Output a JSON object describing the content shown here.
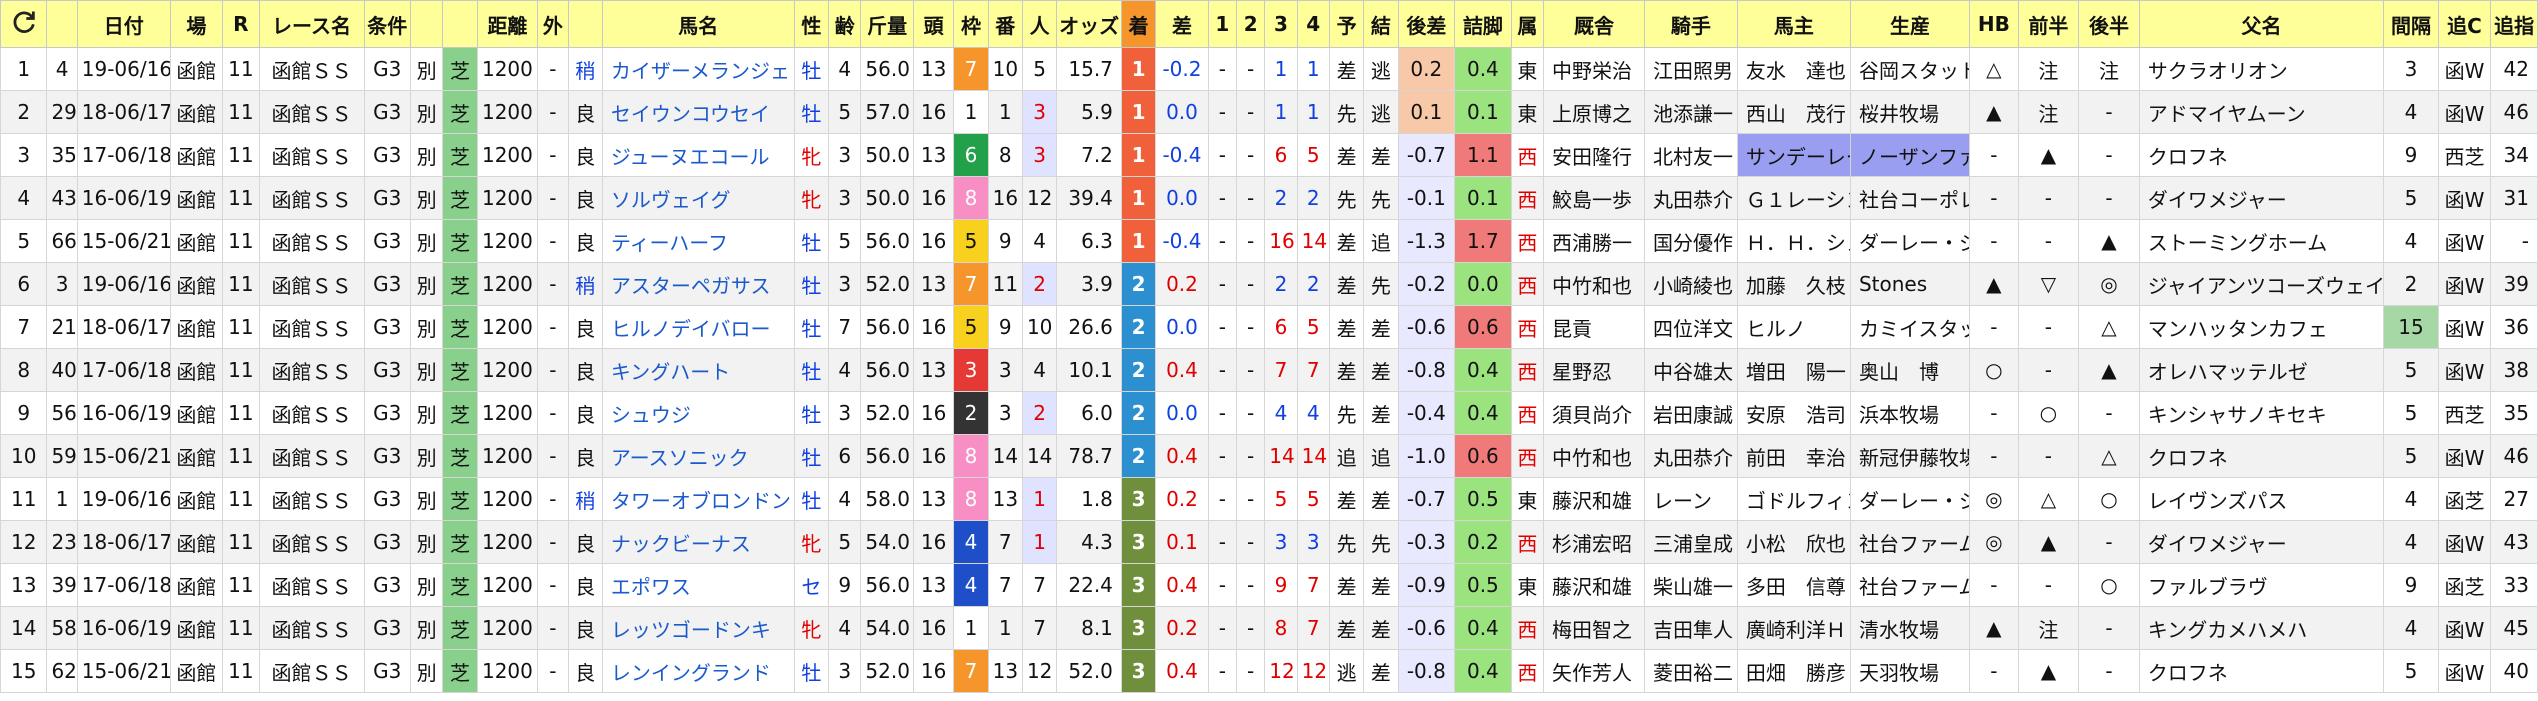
{
  "header": {
    "refresh_icon": "refresh-icon",
    "columns": [
      "日付",
      "場",
      "R",
      "レース名",
      "条件",
      "",
      "",
      "距離",
      "外",
      "",
      "馬名",
      "性",
      "齢",
      "斤量",
      "頭",
      "枠",
      "番",
      "人",
      "オッズ",
      "着",
      "差",
      "1",
      "2",
      "3",
      "4",
      "予",
      "結",
      "後差",
      "詰脚",
      "属",
      "厩舎",
      "騎手",
      "馬主",
      "生産",
      "HB",
      "前半",
      "後半",
      "父名",
      "間隔",
      "追C",
      "追指"
    ]
  },
  "rows": [
    {
      "no": "1",
      "idx": "4",
      "date": "19-06/16",
      "place": "函館",
      "r": "11",
      "race": "函館ＳＳ",
      "grade": "G3",
      "cond": "別",
      "surf": "芝",
      "dist": "1200",
      "out": "-",
      "weight_mark": "稍",
      "name": "カイザーメランジェ",
      "sex": "牡",
      "age": "4",
      "kin": "56.0",
      "heads": "13",
      "waku": "7",
      "ban": "10",
      "pop": "5",
      "odds": "15.7",
      "fin": "1",
      "diff": "-0.2",
      "c1": "-",
      "c2": "-",
      "c3": "1",
      "c4": "1",
      "yo": "差",
      "ketsu": "逃",
      "agari": "0.2",
      "tsume": "0.4",
      "zoku": "東",
      "stable": "中野栄治",
      "jockey": "江田照男",
      "owner": "友水　達也",
      "breeder": "谷岡スタット",
      "hb": "△",
      "zen": "注",
      "kou": "注",
      "sire": "サクラオリオン",
      "interval": "3",
      "oic": "函W",
      "oishi": "42"
    },
    {
      "no": "2",
      "idx": "29",
      "date": "18-06/17",
      "place": "函館",
      "r": "11",
      "race": "函館ＳＳ",
      "grade": "G3",
      "cond": "別",
      "surf": "芝",
      "dist": "1200",
      "out": "-",
      "weight_mark": "良",
      "name": "セイウンコウセイ",
      "sex": "牡",
      "age": "5",
      "kin": "57.0",
      "heads": "16",
      "waku": "1",
      "ban": "1",
      "pop": "3",
      "odds": "5.9",
      "fin": "1",
      "diff": "0.0",
      "c1": "-",
      "c2": "-",
      "c3": "1",
      "c4": "1",
      "yo": "先",
      "ketsu": "逃",
      "agari": "0.1",
      "tsume": "0.1",
      "zoku": "東",
      "stable": "上原博之",
      "jockey": "池添謙一",
      "owner": "西山　茂行",
      "breeder": "桜井牧場",
      "hb": "▲",
      "zen": "注",
      "kou": "-",
      "sire": "アドマイヤムーン",
      "interval": "4",
      "oic": "函W",
      "oishi": "46"
    },
    {
      "no": "3",
      "idx": "35",
      "date": "17-06/18",
      "place": "函館",
      "r": "11",
      "race": "函館ＳＳ",
      "grade": "G3",
      "cond": "別",
      "surf": "芝",
      "dist": "1200",
      "out": "-",
      "weight_mark": "良",
      "name": "ジューヌエコール",
      "sex": "牝",
      "age": "3",
      "kin": "50.0",
      "heads": "13",
      "waku": "6",
      "ban": "8",
      "pop": "3",
      "odds": "7.2",
      "fin": "1",
      "diff": "-0.4",
      "c1": "-",
      "c2": "-",
      "c3": "6",
      "c4": "5",
      "yo": "差",
      "ketsu": "差",
      "agari": "-0.7",
      "tsume": "1.1",
      "zoku": "西",
      "stable": "安田隆行",
      "jockey": "北村友一",
      "owner": "サンデーレー",
      "breeder": "ノーザンファ",
      "hb": "-",
      "zen": "▲",
      "kou": "-",
      "sire": "クロフネ",
      "interval": "9",
      "oic": "西芝",
      "oishi": "34"
    },
    {
      "no": "4",
      "idx": "43",
      "date": "16-06/19",
      "place": "函館",
      "r": "11",
      "race": "函館ＳＳ",
      "grade": "G3",
      "cond": "別",
      "surf": "芝",
      "dist": "1200",
      "out": "-",
      "weight_mark": "良",
      "name": "ソルヴェイグ",
      "sex": "牝",
      "age": "3",
      "kin": "50.0",
      "heads": "16",
      "waku": "8",
      "ban": "16",
      "pop": "12",
      "odds": "39.4",
      "fin": "1",
      "diff": "0.0",
      "c1": "-",
      "c2": "-",
      "c3": "2",
      "c4": "2",
      "yo": "先",
      "ketsu": "先",
      "agari": "-0.1",
      "tsume": "0.1",
      "zoku": "西",
      "stable": "鮫島一歩",
      "jockey": "丸田恭介",
      "owner": "Ｇ１レーシン",
      "breeder": "社台コーポレ",
      "hb": "-",
      "zen": "-",
      "kou": "-",
      "sire": "ダイワメジャー",
      "interval": "5",
      "oic": "函W",
      "oishi": "31"
    },
    {
      "no": "5",
      "idx": "66",
      "date": "15-06/21",
      "place": "函館",
      "r": "11",
      "race": "函館ＳＳ",
      "grade": "G3",
      "cond": "別",
      "surf": "芝",
      "dist": "1200",
      "out": "-",
      "weight_mark": "良",
      "name": "ティーハーフ",
      "sex": "牡",
      "age": "5",
      "kin": "56.0",
      "heads": "16",
      "waku": "5",
      "ban": "9",
      "pop": "4",
      "odds": "6.3",
      "fin": "1",
      "diff": "-0.4",
      "c1": "-",
      "c2": "-",
      "c3": "16",
      "c4": "14",
      "yo": "差",
      "ketsu": "追",
      "agari": "-1.3",
      "tsume": "1.7",
      "zoku": "西",
      "stable": "西浦勝一",
      "jockey": "国分優作",
      "owner": "Ｈ．Ｈ．シェ",
      "breeder": "ダーレー・ジ",
      "hb": "-",
      "zen": "-",
      "kou": "▲",
      "sire": "ストーミングホーム",
      "interval": "4",
      "oic": "函W",
      "oishi": "-"
    },
    {
      "no": "6",
      "idx": "3",
      "date": "19-06/16",
      "place": "函館",
      "r": "11",
      "race": "函館ＳＳ",
      "grade": "G3",
      "cond": "別",
      "surf": "芝",
      "dist": "1200",
      "out": "-",
      "weight_mark": "稍",
      "name": "アスターペガサス",
      "sex": "牡",
      "age": "3",
      "kin": "52.0",
      "heads": "13",
      "waku": "7",
      "ban": "11",
      "pop": "2",
      "odds": "3.9",
      "fin": "2",
      "diff": "0.2",
      "c1": "-",
      "c2": "-",
      "c3": "2",
      "c4": "2",
      "yo": "差",
      "ketsu": "先",
      "agari": "-0.2",
      "tsume": "0.0",
      "zoku": "西",
      "stable": "中竹和也",
      "jockey": "小崎綾也",
      "owner": "加藤　久枝",
      "breeder": "Stones",
      "hb": "▲",
      "zen": "▽",
      "kou": "◎",
      "sire": "ジャイアンツコーズウェイ",
      "interval": "2",
      "oic": "函W",
      "oishi": "39"
    },
    {
      "no": "7",
      "idx": "21",
      "date": "18-06/17",
      "place": "函館",
      "r": "11",
      "race": "函館ＳＳ",
      "grade": "G3",
      "cond": "別",
      "surf": "芝",
      "dist": "1200",
      "out": "-",
      "weight_mark": "良",
      "name": "ヒルノデイバロー",
      "sex": "牡",
      "age": "7",
      "kin": "56.0",
      "heads": "16",
      "waku": "5",
      "ban": "9",
      "pop": "10",
      "odds": "26.6",
      "fin": "2",
      "diff": "0.0",
      "c1": "-",
      "c2": "-",
      "c3": "6",
      "c4": "5",
      "yo": "差",
      "ketsu": "差",
      "agari": "-0.6",
      "tsume": "0.6",
      "zoku": "西",
      "stable": "昆貢",
      "jockey": "四位洋文",
      "owner": "ヒルノ",
      "breeder": "カミイスタッ",
      "hb": "-",
      "zen": "-",
      "kou": "△",
      "sire": "マンハッタンカフェ",
      "interval": "15",
      "oic": "函W",
      "oishi": "36"
    },
    {
      "no": "8",
      "idx": "40",
      "date": "17-06/18",
      "place": "函館",
      "r": "11",
      "race": "函館ＳＳ",
      "grade": "G3",
      "cond": "別",
      "surf": "芝",
      "dist": "1200",
      "out": "-",
      "weight_mark": "良",
      "name": "キングハート",
      "sex": "牡",
      "age": "4",
      "kin": "56.0",
      "heads": "13",
      "waku": "3",
      "ban": "3",
      "pop": "4",
      "odds": "10.1",
      "fin": "2",
      "diff": "0.4",
      "c1": "-",
      "c2": "-",
      "c3": "7",
      "c4": "7",
      "yo": "差",
      "ketsu": "差",
      "agari": "-0.8",
      "tsume": "0.4",
      "zoku": "西",
      "stable": "星野忍",
      "jockey": "中谷雄太",
      "owner": "増田　陽一",
      "breeder": "奥山　博",
      "hb": "○",
      "zen": "-",
      "kou": "▲",
      "sire": "オレハマッテルゼ",
      "interval": "5",
      "oic": "函W",
      "oishi": "38"
    },
    {
      "no": "9",
      "idx": "56",
      "date": "16-06/19",
      "place": "函館",
      "r": "11",
      "race": "函館ＳＳ",
      "grade": "G3",
      "cond": "別",
      "surf": "芝",
      "dist": "1200",
      "out": "-",
      "weight_mark": "良",
      "name": "シュウジ",
      "sex": "牡",
      "age": "3",
      "kin": "52.0",
      "heads": "16",
      "waku": "2",
      "ban": "3",
      "pop": "2",
      "odds": "6.0",
      "fin": "2",
      "diff": "0.0",
      "c1": "-",
      "c2": "-",
      "c3": "4",
      "c4": "4",
      "yo": "先",
      "ketsu": "差",
      "agari": "-0.4",
      "tsume": "0.4",
      "zoku": "西",
      "stable": "須貝尚介",
      "jockey": "岩田康誠",
      "owner": "安原　浩司",
      "breeder": "浜本牧場",
      "hb": "-",
      "zen": "○",
      "kou": "-",
      "sire": "キンシャサノキセキ",
      "interval": "5",
      "oic": "西芝",
      "oishi": "35"
    },
    {
      "no": "10",
      "idx": "59",
      "date": "15-06/21",
      "place": "函館",
      "r": "11",
      "race": "函館ＳＳ",
      "grade": "G3",
      "cond": "別",
      "surf": "芝",
      "dist": "1200",
      "out": "-",
      "weight_mark": "良",
      "name": "アースソニック",
      "sex": "牡",
      "age": "6",
      "kin": "56.0",
      "heads": "16",
      "waku": "8",
      "ban": "14",
      "pop": "14",
      "odds": "78.7",
      "fin": "2",
      "diff": "0.4",
      "c1": "-",
      "c2": "-",
      "c3": "14",
      "c4": "14",
      "yo": "追",
      "ketsu": "追",
      "agari": "-1.0",
      "tsume": "0.6",
      "zoku": "西",
      "stable": "中竹和也",
      "jockey": "丸田恭介",
      "owner": "前田　幸治",
      "breeder": "新冠伊藤牧場",
      "hb": "-",
      "zen": "-",
      "kou": "△",
      "sire": "クロフネ",
      "interval": "5",
      "oic": "函W",
      "oishi": "46"
    },
    {
      "no": "11",
      "idx": "1",
      "date": "19-06/16",
      "place": "函館",
      "r": "11",
      "race": "函館ＳＳ",
      "grade": "G3",
      "cond": "別",
      "surf": "芝",
      "dist": "1200",
      "out": "-",
      "weight_mark": "稍",
      "name": "タワーオブロンドン",
      "sex": "牡",
      "age": "4",
      "kin": "58.0",
      "heads": "13",
      "waku": "8",
      "ban": "13",
      "pop": "1",
      "odds": "1.8",
      "fin": "3",
      "diff": "0.2",
      "c1": "-",
      "c2": "-",
      "c3": "5",
      "c4": "5",
      "yo": "差",
      "ketsu": "差",
      "agari": "-0.7",
      "tsume": "0.5",
      "zoku": "東",
      "stable": "藤沢和雄",
      "jockey": "レーン",
      "owner": "ゴドルフィン",
      "breeder": "ダーレー・ジ",
      "hb": "◎",
      "zen": "△",
      "kou": "○",
      "sire": "レイヴンズパス",
      "interval": "4",
      "oic": "函芝",
      "oishi": "27"
    },
    {
      "no": "12",
      "idx": "23",
      "date": "18-06/17",
      "place": "函館",
      "r": "11",
      "race": "函館ＳＳ",
      "grade": "G3",
      "cond": "別",
      "surf": "芝",
      "dist": "1200",
      "out": "-",
      "weight_mark": "良",
      "name": "ナックビーナス",
      "sex": "牝",
      "age": "5",
      "kin": "54.0",
      "heads": "16",
      "waku": "4",
      "ban": "7",
      "pop": "1",
      "odds": "4.3",
      "fin": "3",
      "diff": "0.1",
      "c1": "-",
      "c2": "-",
      "c3": "3",
      "c4": "3",
      "yo": "先",
      "ketsu": "先",
      "agari": "-0.3",
      "tsume": "0.2",
      "zoku": "西",
      "stable": "杉浦宏昭",
      "jockey": "三浦皇成",
      "owner": "小松　欣也",
      "breeder": "社台ファーム",
      "hb": "◎",
      "zen": "▲",
      "kou": "-",
      "sire": "ダイワメジャー",
      "interval": "4",
      "oic": "函W",
      "oishi": "43"
    },
    {
      "no": "13",
      "idx": "39",
      "date": "17-06/18",
      "place": "函館",
      "r": "11",
      "race": "函館ＳＳ",
      "grade": "G3",
      "cond": "別",
      "surf": "芝",
      "dist": "1200",
      "out": "-",
      "weight_mark": "良",
      "name": "エポワス",
      "sex": "セ",
      "age": "9",
      "kin": "56.0",
      "heads": "13",
      "waku": "4",
      "ban": "7",
      "pop": "7",
      "odds": "22.4",
      "fin": "3",
      "diff": "0.4",
      "c1": "-",
      "c2": "-",
      "c3": "9",
      "c4": "7",
      "yo": "差",
      "ketsu": "差",
      "agari": "-0.9",
      "tsume": "0.5",
      "zoku": "東",
      "stable": "藤沢和雄",
      "jockey": "柴山雄一",
      "owner": "多田　信尊",
      "breeder": "社台ファーム",
      "hb": "-",
      "zen": "-",
      "kou": "○",
      "sire": "ファルブラヴ",
      "interval": "9",
      "oic": "函芝",
      "oishi": "33"
    },
    {
      "no": "14",
      "idx": "58",
      "date": "16-06/19",
      "place": "函館",
      "r": "11",
      "race": "函館ＳＳ",
      "grade": "G3",
      "cond": "別",
      "surf": "芝",
      "dist": "1200",
      "out": "-",
      "weight_mark": "良",
      "name": "レッツゴードンキ",
      "sex": "牝",
      "age": "4",
      "kin": "54.0",
      "heads": "16",
      "waku": "1",
      "ban": "1",
      "pop": "7",
      "odds": "8.1",
      "fin": "3",
      "diff": "0.2",
      "c1": "-",
      "c2": "-",
      "c3": "8",
      "c4": "7",
      "yo": "差",
      "ketsu": "差",
      "agari": "-0.6",
      "tsume": "0.4",
      "zoku": "西",
      "stable": "梅田智之",
      "jockey": "吉田隼人",
      "owner": "廣崎利洋ＨＤ",
      "breeder": "清水牧場",
      "hb": "▲",
      "zen": "注",
      "kou": "-",
      "sire": "キングカメハメハ",
      "interval": "4",
      "oic": "函W",
      "oishi": "45"
    },
    {
      "no": "15",
      "idx": "62",
      "date": "15-06/21",
      "place": "函館",
      "r": "11",
      "race": "函館ＳＳ",
      "grade": "G3",
      "cond": "別",
      "surf": "芝",
      "dist": "1200",
      "out": "-",
      "weight_mark": "良",
      "name": "レンイングランド",
      "sex": "牡",
      "age": "3",
      "kin": "52.0",
      "heads": "16",
      "waku": "7",
      "ban": "13",
      "pop": "12",
      "odds": "52.0",
      "fin": "3",
      "diff": "0.4",
      "c1": "-",
      "c2": "-",
      "c3": "12",
      "c4": "12",
      "yo": "逃",
      "ketsu": "差",
      "agari": "-0.8",
      "tsume": "0.4",
      "zoku": "西",
      "stable": "矢作芳人",
      "jockey": "菱田裕二",
      "owner": "田畑　勝彦",
      "breeder": "天羽牧場",
      "hb": "-",
      "zen": "▲",
      "kou": "-",
      "sire": "クロフネ",
      "interval": "5",
      "oic": "函W",
      "oishi": "40"
    }
  ]
}
